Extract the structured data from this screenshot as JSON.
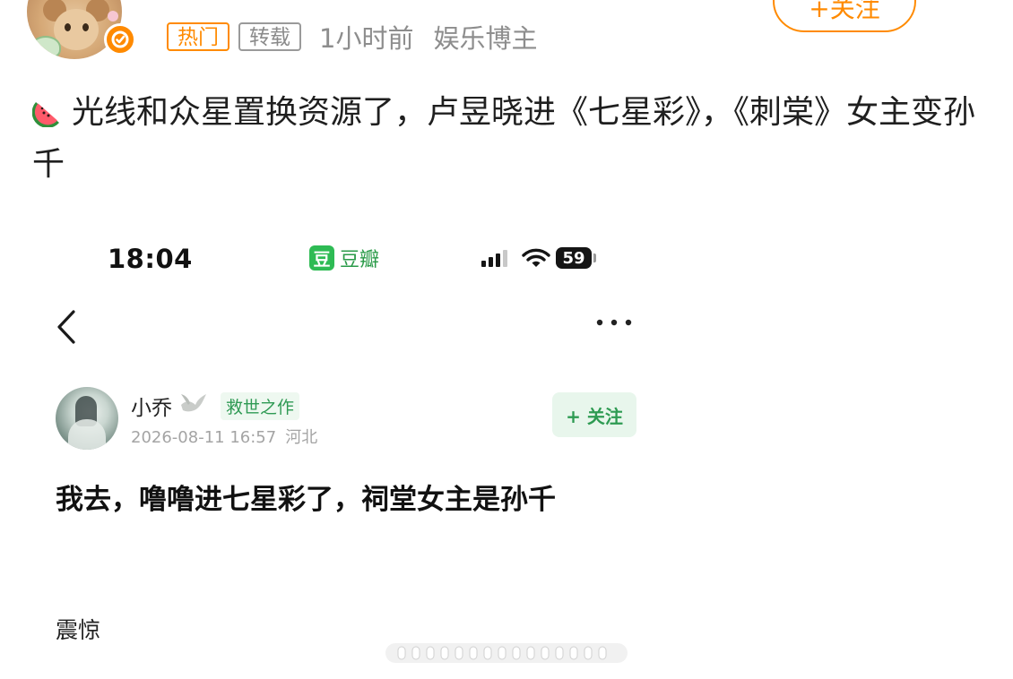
{
  "colors": {
    "weibo_orange": "#ff8a00",
    "douban_green": "#2ebb54",
    "meta_gray": "#8d8d8d",
    "text_dark": "#1f1f1f"
  },
  "post_header": {
    "avatar_icon": "cat-avatar",
    "verified_icon": "orange-verified-badge",
    "tags": [
      "热门",
      "转载"
    ],
    "time": "1小时前",
    "source": "娱乐博主",
    "follow_label": "+关注"
  },
  "post": {
    "emoji_icon": "watermelon-emoji",
    "text": "光线和众星置换资源了，卢昱晓进《七星彩》，《刺棠》女主变孙千"
  },
  "embedded_screenshot": {
    "status_bar": {
      "time": "18:04",
      "app_logo": "豆",
      "app_name": "豆瓣",
      "battery": "59",
      "icons": [
        "signal-icon",
        "wifi-icon",
        "battery-icon"
      ]
    },
    "nav": {
      "back_icon": "chevron-left-icon",
      "more_icon": "more-dots-icon"
    },
    "author": {
      "name": "小乔",
      "badge_icon": "dove-icon",
      "tag": "救世之作",
      "date": "2026-08-11 16:57",
      "location": "河北",
      "follow_label": "+ 关注"
    },
    "title": "我去，噜噜进七星彩了，祠堂女主是孙千",
    "body": "震惊"
  }
}
